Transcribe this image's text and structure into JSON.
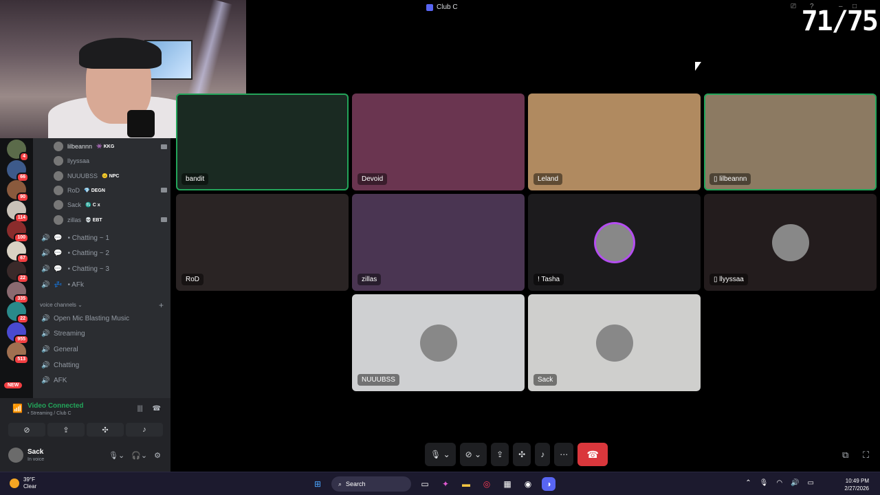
{
  "window": {
    "title": "Club C",
    "counter": "71/75"
  },
  "server_badges": [
    "4",
    "66",
    "90",
    "114",
    "100",
    "67",
    "22",
    "335",
    "22",
    "955",
    "513"
  ],
  "new_label": "NEW",
  "voice_users": [
    {
      "name": "lilbeannn",
      "tag": "KKG",
      "tag_icon": "👾",
      "cam": true,
      "dim": false
    },
    {
      "name": "llyyssaa",
      "tag": "",
      "tag_icon": "",
      "cam": false,
      "dim": true
    },
    {
      "name": "NUUUBSS",
      "tag": "NPC",
      "tag_icon": "😐",
      "cam": false,
      "dim": true
    },
    {
      "name": "RoD",
      "tag": "DEGN",
      "tag_icon": "💎",
      "cam": true,
      "dim": true
    },
    {
      "name": "Sack",
      "tag": "C x",
      "tag_icon": "♏",
      "cam": false,
      "dim": true
    },
    {
      "name": "zillas",
      "tag": "EBT",
      "tag_icon": "💀",
      "cam": true,
      "dim": true
    }
  ],
  "text_channels": [
    {
      "name": "• Chatting ~ 1",
      "icon": "💬"
    },
    {
      "name": "• Chatting ~ 2",
      "icon": "💬"
    },
    {
      "name": "• Chatting ~ 3",
      "icon": "💬"
    },
    {
      "name": "• AFk",
      "icon": "💤"
    }
  ],
  "voice_category": "voice channels",
  "voice_channels": [
    "Open Mic Blasting Music",
    "Streaming",
    "General",
    "Chatting",
    "AFK"
  ],
  "panel": {
    "status_title": "Video Connected",
    "status_sub": "• Streaming / Club C",
    "user_name": "Sack",
    "user_status": "In voice"
  },
  "tiles": [
    {
      "name": "bandit",
      "speaking": true,
      "phone": false,
      "avatar": false,
      "bg": "#1a2a22"
    },
    {
      "name": "Devoid",
      "speaking": false,
      "phone": false,
      "avatar": false,
      "bg": "#6a3550"
    },
    {
      "name": "Leland",
      "speaking": false,
      "phone": false,
      "avatar": false,
      "bg": "#b08a60"
    },
    {
      "name": "lilbeannn",
      "speaking": true,
      "phone": true,
      "avatar": false,
      "bg": "#8c7a62"
    },
    {
      "name": "RoD",
      "speaking": false,
      "phone": false,
      "avatar": false,
      "bg": "#2a2424"
    },
    {
      "name": "zillas",
      "speaking": false,
      "phone": false,
      "avatar": false,
      "bg": "#4a3552"
    },
    {
      "name": "! Tasha",
      "speaking": false,
      "phone": false,
      "avatar": true,
      "bg": "#1c1b1d"
    },
    {
      "name": "llyyssaa",
      "speaking": false,
      "phone": true,
      "avatar": true,
      "bg": "#231c1d"
    },
    {
      "name": "NUUUBSS",
      "speaking": false,
      "phone": false,
      "avatar": true,
      "bg": "#cfd0d2"
    },
    {
      "name": "Sack",
      "speaking": false,
      "phone": false,
      "avatar": true,
      "bg": "#cfcfcd"
    }
  ],
  "taskbar": {
    "temp": "39°F",
    "weather": "Clear",
    "search_placeholder": "Search",
    "time": "10:49 PM",
    "date": "2/27/2026"
  },
  "colors": {
    "accent": "#5865f2",
    "speaking": "#23a55a",
    "end_call": "#da373c"
  }
}
